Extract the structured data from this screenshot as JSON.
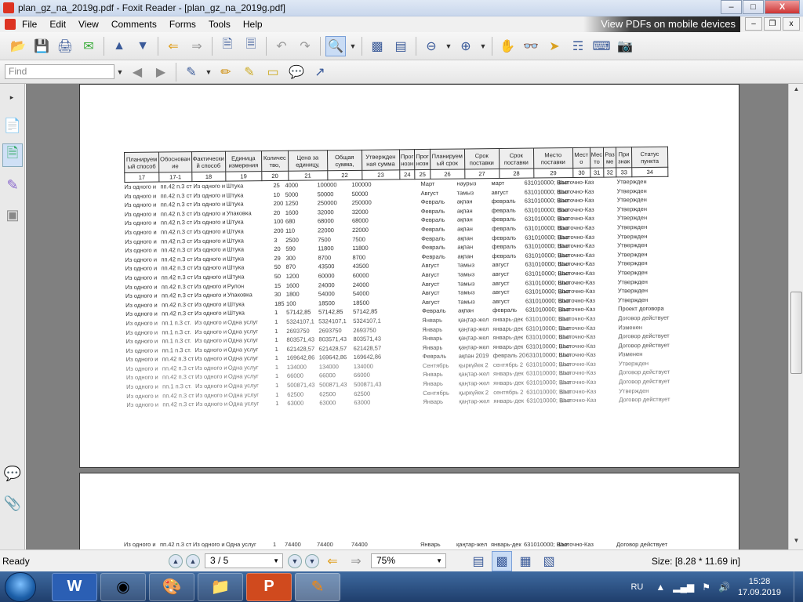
{
  "window": {
    "title": "plan_gz_na_2019g.pdf - Foxit Reader - [plan_gz_na_2019g.pdf]",
    "min_label": "–",
    "max_label": "□",
    "close_label": "X"
  },
  "menu": {
    "items": [
      "File",
      "Edit",
      "View",
      "Comments",
      "Forms",
      "Tools",
      "Help"
    ],
    "promo": "View PDFs on mobile devices",
    "mdi_min": "–",
    "mdi_restore": "❐",
    "mdi_close": "x"
  },
  "toolbar": {
    "find_placeholder": "Find"
  },
  "table": {
    "headers": [
      {
        "text": "Планируем ый способ",
        "num": "17"
      },
      {
        "text": "Обоснован ие",
        "num": "17-1"
      },
      {
        "text": "Фактически й способ",
        "num": "18"
      },
      {
        "text": "Единица измерения",
        "num": "19"
      },
      {
        "text": "Количес тво,",
        "num": "20"
      },
      {
        "text": "Цена за единицу,",
        "num": "21"
      },
      {
        "text": "Общая сумма,",
        "num": "22"
      },
      {
        "text": "Утвержден ная сумма",
        "num": "23"
      },
      {
        "text": "Прог нозн",
        "num": "24"
      },
      {
        "text": "Прог нозн",
        "num": "25"
      },
      {
        "text": "Планируем ый срок",
        "num": "26"
      },
      {
        "text": "Срок поставки",
        "num": "27"
      },
      {
        "text": "Срок поставки",
        "num": "28"
      },
      {
        "text": "Место поставки",
        "num": "29"
      },
      {
        "text": "Мест о",
        "num": "30"
      },
      {
        "text": "Мес то",
        "num": "31"
      },
      {
        "text": "Раз ме",
        "num": "32"
      },
      {
        "text": "При знак",
        "num": "33"
      },
      {
        "text": "Статус пункта",
        "num": "34"
      }
    ],
    "rows": [
      [
        "Из одного и",
        "пп.42 п.3 ст",
        "Из одного и",
        "Штука",
        "25",
        "4000",
        "100000",
        "100000",
        "Март",
        "наурыз",
        "март",
        "631010000; Шығ",
        "Восточно-Каз",
        "Утвержден"
      ],
      [
        "Из одного и",
        "пп.42 п.3 ст",
        "Из одного и",
        "Штука",
        "10",
        "5000",
        "50000",
        "50000",
        "Август",
        "тамыз",
        "август",
        "631010000; Шығ",
        "Восточно-Каз",
        "Утвержден"
      ],
      [
        "Из одного и",
        "пп.42 п.3 ст",
        "Из одного и",
        "Штука",
        "200",
        "1250",
        "250000",
        "250000",
        "Февраль",
        "ақпан",
        "февраль",
        "631010000; Шығ",
        "Восточно-Каз",
        "Утвержден"
      ],
      [
        "Из одного и",
        "пп.42 п.3 ст",
        "Из одного и",
        "Упаковка",
        "20",
        "1600",
        "32000",
        "32000",
        "Февраль",
        "ақпан",
        "февраль",
        "631010000; Шығ",
        "Восточно-Каз",
        "Утвержден"
      ],
      [
        "Из одного и",
        "пп.42 п.3 ст",
        "Из одного и",
        "Штука",
        "100",
        "680",
        "68000",
        "68000",
        "Февраль",
        "ақпан",
        "февраль",
        "631010000; Шығ",
        "Восточно-Каз",
        "Утвержден"
      ],
      [
        "Из одного и",
        "пп.42 п.3 ст",
        "Из одного и",
        "Штука",
        "200",
        "110",
        "22000",
        "22000",
        "Февраль",
        "ақпан",
        "февраль",
        "631010000; Шығ",
        "Восточно-Каз",
        "Утвержден"
      ],
      [
        "Из одного и",
        "пп.42 п.3 ст",
        "Из одного и",
        "Штука",
        "3",
        "2500",
        "7500",
        "7500",
        "Февраль",
        "ақпан",
        "февраль",
        "631010000; Шығ",
        "Восточно-Каз",
        "Утвержден"
      ],
      [
        "Из одного и",
        "пп.42 п.3 ст",
        "Из одного и",
        "Штука",
        "20",
        "590",
        "11800",
        "11800",
        "Февраль",
        "ақпан",
        "февраль",
        "631010000; Шығ",
        "Восточно-Каз",
        "Утвержден"
      ],
      [
        "Из одного и",
        "пп.42 п.3 ст",
        "Из одного и",
        "Штука",
        "29",
        "300",
        "8700",
        "8700",
        "Февраль",
        "ақпан",
        "февраль",
        "631010000; Шығ",
        "Восточно-Каз",
        "Утвержден"
      ],
      [
        "Из одного и",
        "пп.42 п.3 ст",
        "Из одного и",
        "Штука",
        "50",
        "870",
        "43500",
        "43500",
        "Август",
        "тамыз",
        "август",
        "631010000; Шығ",
        "Восточно-Каз",
        "Утвержден"
      ],
      [
        "Из одного и",
        "пп.42 п.3 ст",
        "Из одного и",
        "Штука",
        "50",
        "1200",
        "60000",
        "60000",
        "Август",
        "тамыз",
        "август",
        "631010000; Шығ",
        "Восточно-Каз",
        "Утвержден"
      ],
      [
        "Из одного и",
        "пп.42 п.3 ст",
        "Из одного и",
        "Рулон",
        "15",
        "1600",
        "24000",
        "24000",
        "Август",
        "тамыз",
        "август",
        "631010000; Шығ",
        "Восточно-Каз",
        "Утвержден"
      ],
      [
        "Из одного и",
        "пп.42 п.3 ст",
        "Из одного и",
        "Упаковка",
        "30",
        "1800",
        "54000",
        "54000",
        "Август",
        "тамыз",
        "август",
        "631010000; Шығ",
        "Восточно-Каз",
        "Утвержден"
      ],
      [
        "Из одного и",
        "пп.42 п.3 ст",
        "Из одного и",
        "Штука",
        "185",
        "100",
        "18500",
        "18500",
        "Август",
        "тамыз",
        "август",
        "631010000; Шығ",
        "Восточно-Каз",
        "Утвержден"
      ],
      [
        "Из одного и",
        "пп.42 п.3 ст",
        "Из одного и",
        "Штука",
        "1",
        "57142,85",
        "57142,85",
        "57142,85",
        "Февраль",
        "ақпан",
        "февраль",
        "631010000; Шығ",
        "Восточно-Каз",
        "Проект договора"
      ],
      [
        "Из одного и",
        "пп.1 п.3 ст.",
        "Из одного и",
        "Одна услуг",
        "1",
        "5324107,1",
        "5324107,1",
        "5324107,1",
        "Январь",
        "қаңтар-жел",
        "январь-дек",
        "631010000; Шығ",
        "Восточно-Каз",
        "Договор действует"
      ],
      [
        "Из одного и",
        "пп.1 п.3 ст.",
        "Из одного и",
        "Одна услуг",
        "1",
        "2693750",
        "2693750",
        "2693750",
        "Январь",
        "қаңтар-жел",
        "январь-дек",
        "631010000; Шығ",
        "Восточно-Каз",
        "Изменен"
      ],
      [
        "Из одного и",
        "пп.1 п.3 ст.",
        "Из одного и",
        "Одна услуг",
        "1",
        "803571,43",
        "803571,43",
        "803571,43",
        "Январь",
        "қаңтар-жел",
        "январь-дек",
        "631010000; Шығ",
        "Восточно-Каз",
        "Договор действует"
      ],
      [
        "Из одного и",
        "пп.1 п.3 ст.",
        "Из одного и",
        "Одна услуг",
        "1",
        "621428,57",
        "621428,57",
        "621428,57",
        "Январь",
        "қаңтар-жел",
        "январь-дек",
        "631010000; Шығ",
        "Восточно-Каз",
        "Договор действует"
      ],
      [
        "Из одного и",
        "пп.42 п.3 ст",
        "Из одного и",
        "Одна услуг",
        "1",
        "169642,86",
        "169642,86",
        "169642,86",
        "Февраль",
        "ақпан 2019",
        "февраль 20",
        "631010000; Шығ",
        "Восточно-Каз",
        "Изменен"
      ],
      [
        "Из одного и",
        "пп.42 п.3 ст",
        "Из одного и",
        "Одна услуг",
        "1",
        "134000",
        "134000",
        "134000",
        "Сентябрь",
        "қыркүйек 2",
        "сентябрь 2",
        "631010000; Шығ",
        "Восточно-Каз",
        "Утвержден"
      ],
      [
        "Из одного и",
        "пп.42 п.3 ст",
        "Из одного и",
        "Одна услуг",
        "1",
        "66000",
        "66000",
        "66000",
        "Январь",
        "қаңтар-жел",
        "январь-дек",
        "631010000; Шығ",
        "Восточно-Каз",
        "Договор действует"
      ],
      [
        "Из одного и",
        "пп.1 п.3 ст.",
        "Из одного и",
        "Одна услуг",
        "1",
        "500871,43",
        "500871,43",
        "500871,43",
        "Январь",
        "қаңтар-жел",
        "январь-дек",
        "631010000; Шығ",
        "Восточно-Каз",
        "Договор действует"
      ],
      [
        "Из одного и",
        "пп.42 п.3 ст",
        "Из одного и",
        "Одна услуг",
        "1",
        "62500",
        "62500",
        "62500",
        "Сентябрь",
        "қыркүйек 2",
        "сентябрь 2",
        "631010000; Шығ",
        "Восточно-Каз",
        "Утвержден"
      ],
      [
        "Из одного и",
        "пп.42 п.3 ст",
        "Из одного и",
        "Одна услуг",
        "1",
        "63000",
        "63000",
        "63000",
        "Январь",
        "қаңтар-жел",
        "январь-дек",
        "631010000; Шығ",
        "Восточно-Каз",
        "Договор действует"
      ]
    ],
    "page2_row": [
      "Из одного и",
      "пп.42 п.3 ст",
      "Из одного и",
      "Одна услуг",
      "1",
      "74400",
      "74400",
      "74400",
      "Январь",
      "қаңтар-жел",
      "январь-дек",
      "631010000; Шығ",
      "Восточно-Каз",
      "Договор действует"
    ]
  },
  "status": {
    "ready": "Ready",
    "page": "3 / 5",
    "zoom": "75%",
    "size": "Size: [8.28 * 11.69 in]"
  },
  "taskbar": {
    "lang": "RU",
    "time": "15:28",
    "date": "17.09.2019"
  }
}
